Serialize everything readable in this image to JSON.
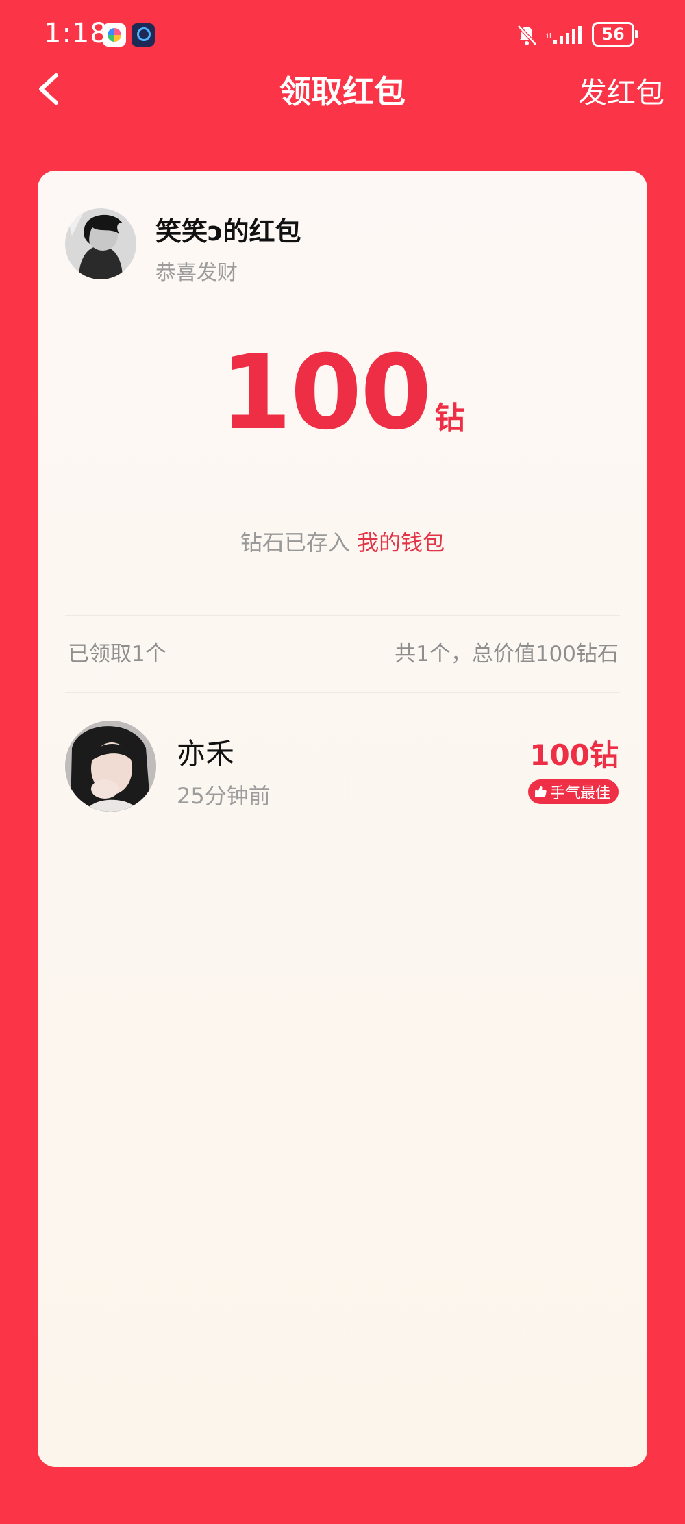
{
  "status_bar": {
    "time": "1:18",
    "battery": "56"
  },
  "header": {
    "title": "领取红包",
    "send_label": "发红包"
  },
  "sender": {
    "name": "笑笑ɔ的红包",
    "wish": "恭喜发财"
  },
  "amount": {
    "value": "100",
    "unit": "钻"
  },
  "wallet_note": {
    "prefix": "钻石已存入",
    "link": "我的钱包"
  },
  "summary": {
    "received": "已领取1个",
    "total": "共1个，总价值100钻石"
  },
  "receivers": [
    {
      "name": "亦禾",
      "time": "25分钟前",
      "amount": "100钻",
      "badge": "手气最佳"
    }
  ],
  "colors": {
    "brand_red": "#fb3447",
    "amount_red": "#ed2e45",
    "card_bg": "#fdf8f5"
  }
}
